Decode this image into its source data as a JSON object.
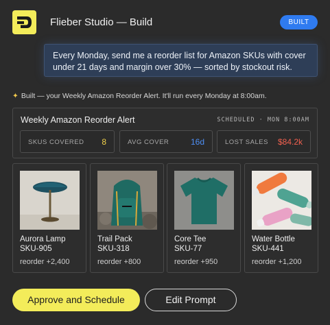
{
  "header": {
    "title": "Flieber Studio — Build",
    "badge": "BUILT",
    "logo_icon": "flieber-logo-icon"
  },
  "prompt": {
    "text": "Every Monday, send me a reorder list for Amazon SKUs with cover under 21 days and margin over 30% — sorted by stockout risk."
  },
  "status": {
    "icon": "sparkle-icon",
    "text": "Built — your Weekly Amazon Reorder Alert. It'll run every Monday at 8:00am."
  },
  "alert": {
    "title": "Weekly Amazon Reorder Alert",
    "schedule": "SCHEDULED · MON 8:00AM",
    "stats": [
      {
        "label": "SKUS COVERED",
        "value": "8",
        "color": "#f2d24b"
      },
      {
        "label": "AVG COVER",
        "value": "16d",
        "color": "#4e8ff5"
      },
      {
        "label": "LOST SALES",
        "value": "$84.2k",
        "color": "#f0604f"
      }
    ]
  },
  "products": [
    {
      "name": "Aurora Lamp",
      "sku": "SKU-905",
      "reorder": "reorder +2,400",
      "icon": "lamp-image"
    },
    {
      "name": "Trail Pack",
      "sku": "SKU-318",
      "reorder": "reorder +800",
      "icon": "backpack-image"
    },
    {
      "name": "Core Tee",
      "sku": "SKU-77",
      "reorder": "reorder +950",
      "icon": "tshirt-image"
    },
    {
      "name": "Water Bottle",
      "sku": "SKU-441",
      "reorder": "reorder +1,200",
      "icon": "water-bottles-image"
    }
  ],
  "actions": {
    "approve": "Approve and Schedule",
    "edit": "Edit Prompt"
  },
  "colors": {
    "brand_yellow": "#f3ec5a",
    "badge_blue": "#2f7bf0",
    "background": "#2b2b2b"
  }
}
